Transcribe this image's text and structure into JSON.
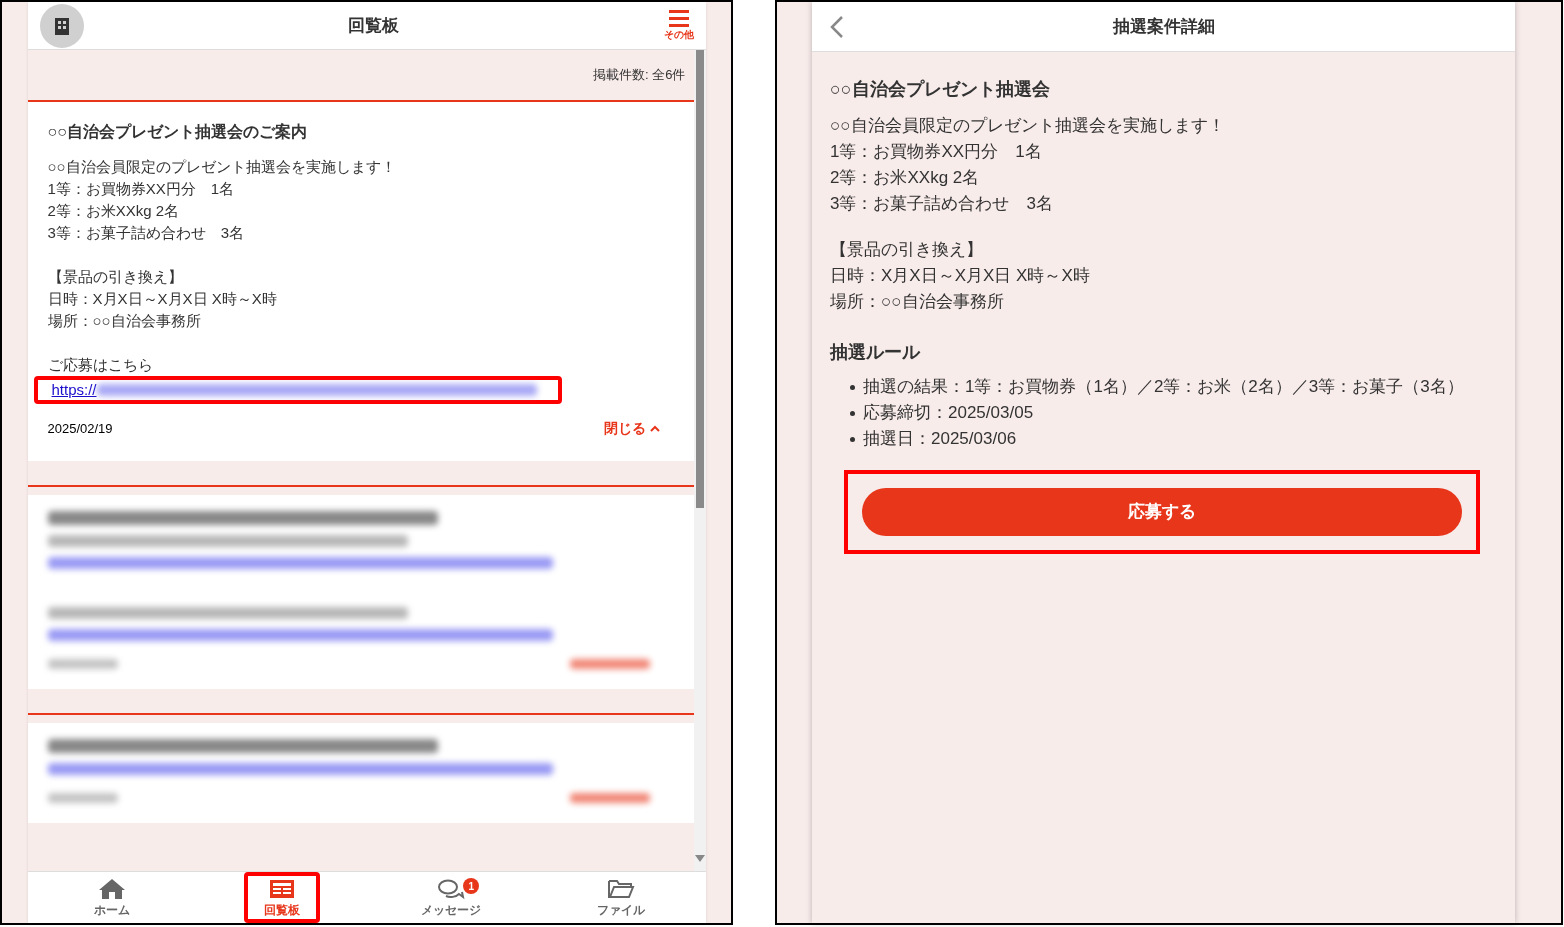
{
  "left_screen": {
    "header": {
      "title": "回覧板",
      "menu_label": "その他"
    },
    "post_count": "掲載件数: 全6件",
    "posts": [
      {
        "kind": "expanded",
        "title": "○○自治会プレゼント抽選会のご案内",
        "paragraphs": [
          [
            "○○自治会員限定のプレゼント抽選会を実施します！",
            "1等：お買物券XX円分　1名",
            "2等：お米XXkg 2名",
            "3等：お菓子詰め合わせ　3名"
          ],
          [
            "【景品の引き換え】",
            "日時：X月X日～X月X日 X時～X時",
            "場所：○○自治会事務所"
          ],
          [
            "ご応募はこちら"
          ]
        ],
        "link": {
          "text": "https://",
          "highlighted": true
        },
        "date": "2025/02/19",
        "toggle": "閉じる"
      },
      {
        "kind": "blurred",
        "rows": [
          {
            "kind": "title"
          },
          {
            "kind": "text"
          },
          {
            "kind": "link"
          },
          {
            "kind": "gap"
          },
          {
            "kind": "text"
          },
          {
            "kind": "link"
          },
          {
            "kind": "footer"
          }
        ]
      },
      {
        "kind": "blurred",
        "rows": [
          {
            "kind": "title"
          },
          {
            "kind": "link"
          },
          {
            "kind": "footer"
          }
        ]
      }
    ],
    "nav": [
      {
        "label": "ホーム",
        "selected": false,
        "highlighted": false
      },
      {
        "label": "回覧板",
        "selected": true,
        "highlighted": true
      },
      {
        "label": "メッセージ",
        "selected": false,
        "highlighted": false,
        "badge": "1"
      },
      {
        "label": "ファイル",
        "selected": false,
        "highlighted": false
      }
    ]
  },
  "right_screen": {
    "header": {
      "title": "抽選案件詳細"
    },
    "title": "○○自治会プレゼント抽選会",
    "paragraphs": [
      [
        "○○自治会員限定のプレゼント抽選会を実施します！",
        "1等：お買物券XX円分　1名",
        "2等：お米XXkg 2名",
        "3等：お菓子詰め合わせ　3名"
      ],
      [
        "【景品の引き換え】",
        "日時：X月X日～X月X日 X時～X時",
        "場所：○○自治会事務所"
      ]
    ],
    "rules_heading": "抽選ルール",
    "rules": [
      "抽選の結果：1等：お買物券（1名）／2等：お米（2名）／3等：お菓子（3名）",
      "応募締切：2025/03/05",
      "抽選日：2025/03/06"
    ],
    "apply_button": {
      "label": "応募する",
      "highlighted": true
    }
  }
}
